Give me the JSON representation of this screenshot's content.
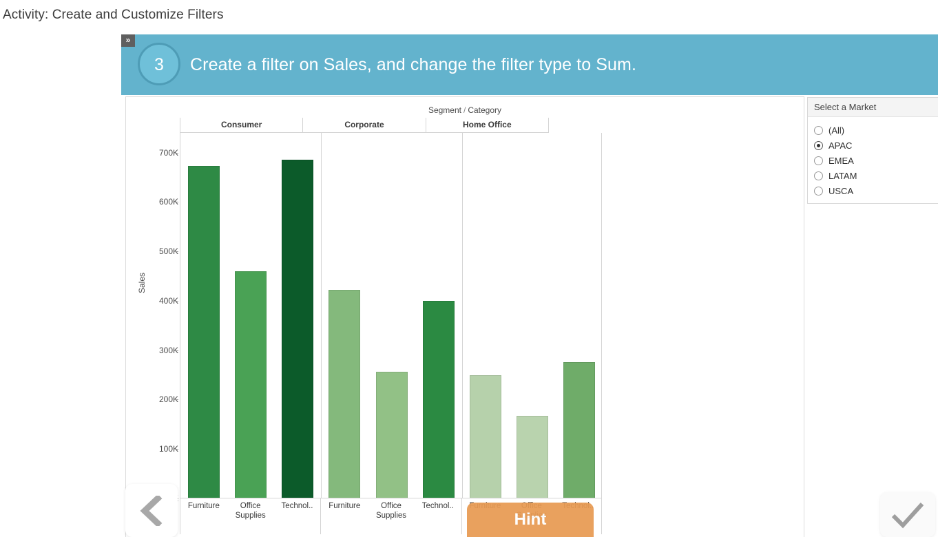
{
  "page": {
    "activity_title": "Activity: Create and Customize Filters"
  },
  "banner": {
    "expand_icon": "»",
    "step_number": "3",
    "instruction": "Create a filter on Sales, and change the filter type to Sum.",
    "background_color": "#63b3cd",
    "circle_color": "#6fc0d9"
  },
  "market_filter": {
    "title": "Select a Market",
    "options": [
      {
        "label": "(All)",
        "selected": false
      },
      {
        "label": "APAC",
        "selected": true
      },
      {
        "label": "EMEA",
        "selected": false
      },
      {
        "label": "LATAM",
        "selected": false
      },
      {
        "label": "USCA",
        "selected": false
      }
    ]
  },
  "controls": {
    "prev_label": "‹",
    "hint_label": "Hint",
    "done_label": "✓"
  },
  "chart_data": {
    "type": "bar",
    "title": "Segment / Category",
    "title_parts": {
      "left": "Segment",
      "sep": "/",
      "right": "Category"
    },
    "xlabel": "",
    "ylabel": "Sales",
    "ylim": [
      0,
      740000
    ],
    "grid": false,
    "y_ticks": [
      "0K",
      "100K",
      "200K",
      "300K",
      "400K",
      "500K",
      "600K",
      "700K"
    ],
    "y_tick_values": [
      0,
      100000,
      200000,
      300000,
      400000,
      500000,
      600000,
      700000
    ],
    "groups": [
      "Consumer",
      "Corporate",
      "Home Office"
    ],
    "categories": [
      "Furniture",
      "Office Supplies",
      "Technol..",
      "Furniture",
      "Office Supplies",
      "Technol..",
      "Furniture",
      "Office Supplies",
      "Technol.."
    ],
    "bars": [
      {
        "group": "Consumer",
        "category": "Furniture",
        "value": 672000,
        "color": "#2e8a45"
      },
      {
        "group": "Consumer",
        "category": "Office Supplies",
        "value": 458000,
        "color": "#4aa255"
      },
      {
        "group": "Consumer",
        "category": "Technol..",
        "value": 684000,
        "color": "#0c5b2a"
      },
      {
        "group": "Corporate",
        "category": "Furniture",
        "value": 421000,
        "color": "#84b97c"
      },
      {
        "group": "Corporate",
        "category": "Office Supplies",
        "value": 255000,
        "color": "#92c186"
      },
      {
        "group": "Corporate",
        "category": "Technol..",
        "value": 398000,
        "color": "#2b8a42"
      },
      {
        "group": "Home Office",
        "category": "Furniture",
        "value": 248000,
        "color": "#b6d1ab"
      },
      {
        "group": "Home Office",
        "category": "Office Supplies",
        "value": 166000,
        "color": "#b9d3ae"
      },
      {
        "group": "Home Office",
        "category": "Technol..",
        "value": 274000,
        "color": "#6fac69"
      }
    ]
  }
}
